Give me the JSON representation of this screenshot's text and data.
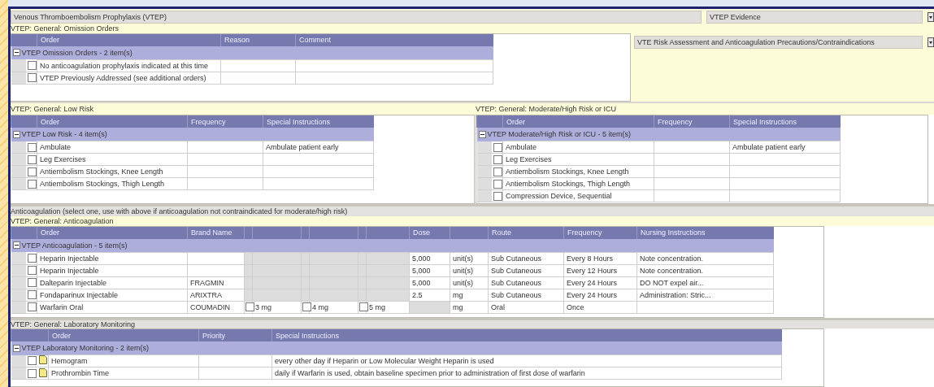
{
  "header": {
    "title": "Venous Thromboembolism Prophylaxis (VTEP)",
    "evidence": "VTEP Evidence"
  },
  "omission": {
    "title": "VTEP: General: Omission Orders",
    "columns": [
      "Order",
      "Reason",
      "Comment"
    ],
    "group": "VTEP Omission Orders - 2 item(s)",
    "expanded": true,
    "rows": [
      {
        "checked": false,
        "order": "No anticoagulation prophylaxis indicated at this time"
      },
      {
        "checked": false,
        "order": "VTEP Previously Addressed (see additional orders)"
      }
    ]
  },
  "risk_assessment": {
    "label": "VTE Risk Assessment and Anticoagulation Precautions/Contraindications"
  },
  "risk_sections": [
    {
      "title": "VTEP: General: Low Risk",
      "columns": [
        "Order",
        "Frequency",
        "Special Instructions"
      ],
      "group": "VTEP Low Risk - 4 item(s)",
      "expanded": true,
      "rows": [
        {
          "checked": false,
          "order": "Ambulate",
          "special_instructions": "Ambulate patient early"
        },
        {
          "checked": false,
          "order": "Leg Exercises"
        },
        {
          "checked": false,
          "order": "Antiembolism Stockings, Knee Length"
        },
        {
          "checked": false,
          "order": "Antiembolism Stockings, Thigh Length"
        }
      ]
    },
    {
      "title": "VTEP: General: Moderate/High Risk or ICU",
      "columns": [
        "Order",
        "Frequency",
        "Special Instructions"
      ],
      "group": "VTEP Moderate/High Risk or ICU - 5 item(s)",
      "expanded": true,
      "rows": [
        {
          "checked": false,
          "order": "Ambulate",
          "special_instructions": "Ambulate patient early"
        },
        {
          "checked": false,
          "order": "Leg Exercises"
        },
        {
          "checked": false,
          "order": "Antiembolism Stockings, Knee Length"
        },
        {
          "checked": false,
          "order": "Antiembolism Stockings, Thigh Length"
        },
        {
          "checked": false,
          "order": "Compression Device, Sequential"
        }
      ]
    }
  ],
  "anticoagulation": {
    "note": "Anticoagulation (select one, use with above if anticoagulation not contraindicated for moderate/high risk)",
    "title": "VTEP: General: Anticoagulation",
    "columns": [
      "Order",
      "Brand Name",
      "Dose",
      "Route",
      "Frequency",
      "Nursing Instructions"
    ],
    "group": "VTEP Anticoagulation - 5 item(s)",
    "expanded": true,
    "rows": [
      {
        "checked": false,
        "order": "Heparin Injectable",
        "dose": "5,000",
        "unit": "unit(s)",
        "route": "Sub Cutaneous",
        "frequency": "Every 8  Hours",
        "nursing": "Note concentration."
      },
      {
        "checked": false,
        "order": "Heparin Injectable",
        "dose": "5,000",
        "unit": "unit(s)",
        "route": "Sub Cutaneous",
        "frequency": "Every 12  Hours",
        "nursing": "Note concentration."
      },
      {
        "checked": false,
        "order": "Dalteparin Injectable",
        "brand": "FRAGMIN",
        "dose": "5,000",
        "unit": "unit(s)",
        "route": "Sub Cutaneous",
        "frequency": "Every  24 Hours",
        "nursing": "DO NOT  expel air..."
      },
      {
        "checked": false,
        "order": "Fondaparinux Injectable",
        "brand": "ARIXTRA",
        "dose": "2.5",
        "unit": "mg",
        "route": "Sub Cutaneous",
        "frequency": "Every  24 Hours",
        "nursing": "Administration: Stric..."
      },
      {
        "checked": false,
        "order": "Warfarin Oral",
        "brand": "COUMADIN",
        "options": [
          {
            "label": "3 mg",
            "checked": false
          },
          {
            "label": "4 mg",
            "checked": false
          },
          {
            "label": "5 mg",
            "checked": false
          }
        ],
        "unit": "mg",
        "route": "Oral",
        "frequency": "Once"
      }
    ]
  },
  "labs": {
    "title": "VTEP: General: Laboratory Monitoring",
    "columns": [
      "Order",
      "Priority",
      "Special Instructions"
    ],
    "group": "VTEP Laboratory Monitoring - 2 item(s)",
    "expanded": true,
    "rows": [
      {
        "checked": false,
        "order": "Hemogram",
        "special_instructions": "every other day if Heparin or Low Molecular Weight Heparin is used"
      },
      {
        "checked": false,
        "order": "Prothrombin Time",
        "special_instructions": "daily if Warfarin is used, obtain baseline specimen prior to administration of first dose of warfarin"
      }
    ]
  }
}
